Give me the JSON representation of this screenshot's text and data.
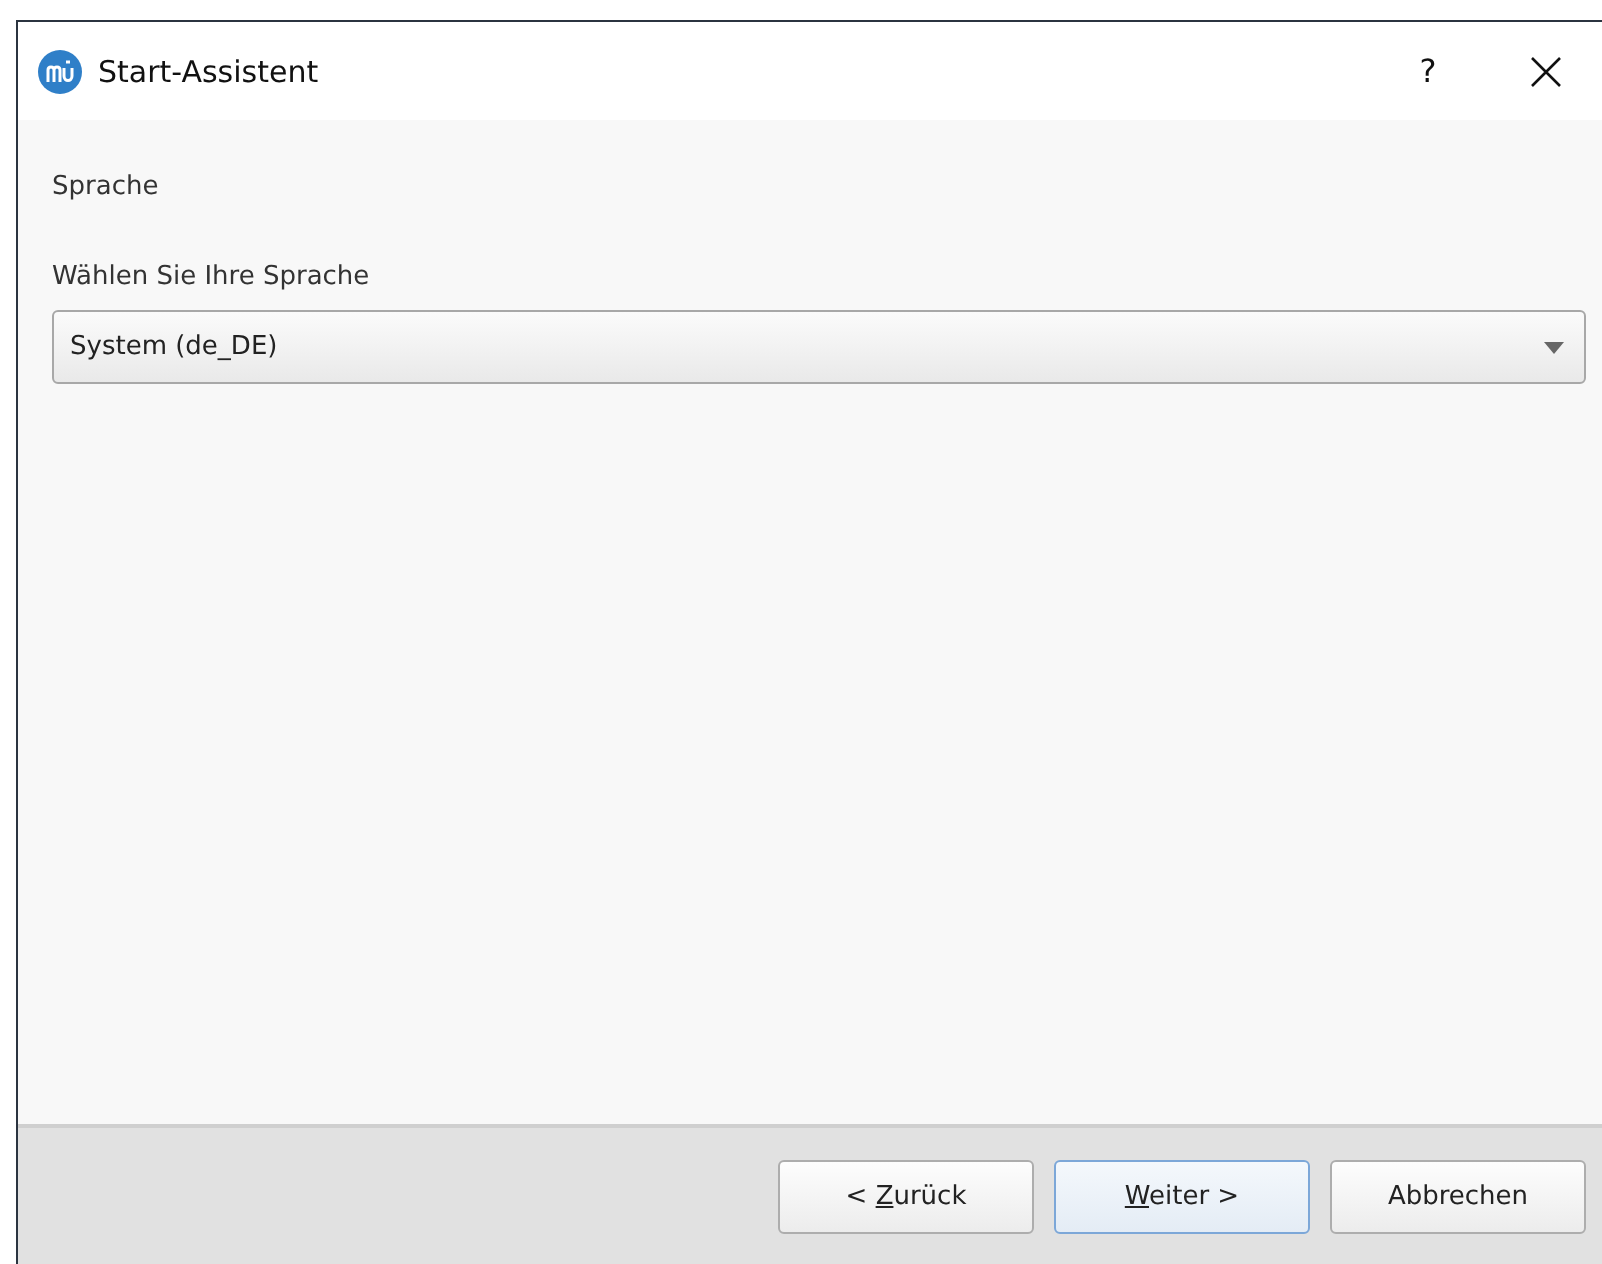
{
  "window": {
    "title": "Start-Assistent",
    "help": "?"
  },
  "page": {
    "heading": "Sprache",
    "field_label": "Wählen Sie Ihre Sprache",
    "language": {
      "value": "System (de_DE)"
    }
  },
  "buttons": [
    {
      "before": "< ",
      "mnemonic": "Z",
      "after": "urück",
      "default": false
    },
    {
      "mnemonic": "W",
      "after": "eiter >",
      "default": true
    },
    {
      "after": "Abbrechen",
      "default": false
    }
  ]
}
